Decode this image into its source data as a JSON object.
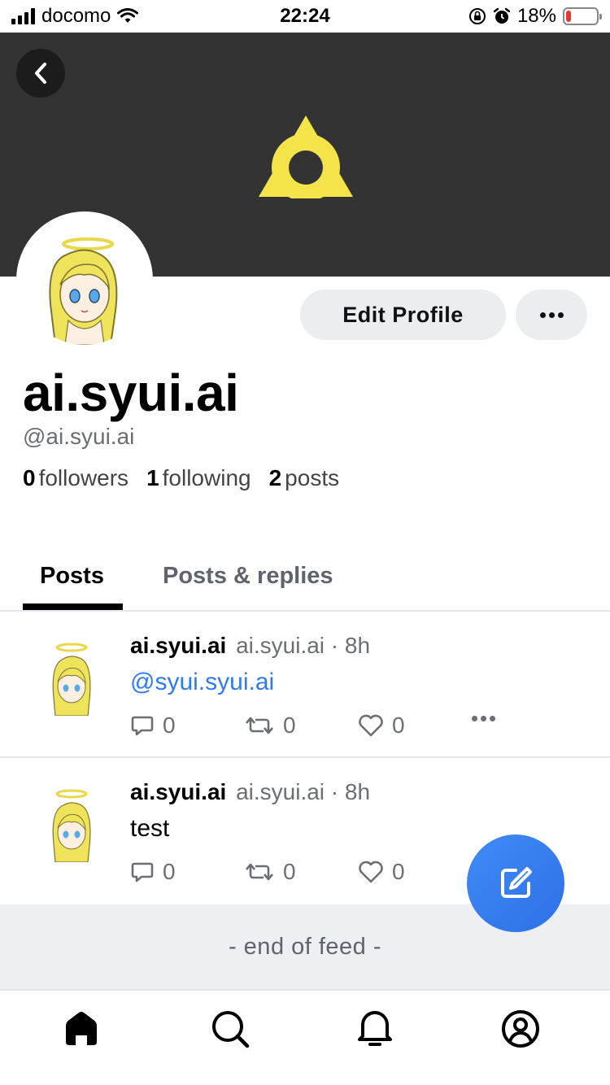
{
  "status_bar": {
    "carrier": "docomo",
    "time": "22:24",
    "battery": "18%",
    "battery_level": 0.18
  },
  "banner": {
    "back_icon": "chevron-left-icon",
    "logo_icon": "triangle-ring-logo",
    "colors": {
      "background": "#333333",
      "logo": "#f4e44a"
    }
  },
  "profile": {
    "display_name": "ai.syui.ai",
    "handle": "@ai.syui.ai",
    "edit_button": "Edit Profile",
    "stats": {
      "followers_count": "0",
      "followers_label": "followers",
      "following_count": "1",
      "following_label": "following",
      "posts_count": "2",
      "posts_label": "posts"
    }
  },
  "tabs": [
    {
      "label": "Posts",
      "active": true
    },
    {
      "label": "Posts & replies",
      "active": false
    }
  ],
  "feed": [
    {
      "author": "ai.syui.ai",
      "handle": "ai.syui.ai",
      "time": "· 8h",
      "text": "@syui.syui.ai",
      "reply_count": "0",
      "repost_count": "0",
      "like_count": "0"
    },
    {
      "author": "ai.syui.ai",
      "handle": "ai.syui.ai",
      "time": "· 8h",
      "text": "test",
      "reply_count": "0",
      "repost_count": "0",
      "like_count": "0"
    }
  ],
  "end_of_feed": "- end of feed -",
  "fab": {
    "icon": "compose-icon",
    "color": "#3a80f2"
  },
  "bottom_nav": [
    {
      "name": "home",
      "icon": "home-icon",
      "active": true
    },
    {
      "name": "search",
      "icon": "search-icon",
      "active": false
    },
    {
      "name": "notifications",
      "icon": "bell-icon",
      "active": false
    },
    {
      "name": "profile",
      "icon": "user-circle-icon",
      "active": false
    }
  ],
  "colors": {
    "accent": "#2f7bf0",
    "muted_text": "#6b6e76",
    "button_bg": "#ecedf1",
    "feed_end_bg": "#eeeff2"
  }
}
